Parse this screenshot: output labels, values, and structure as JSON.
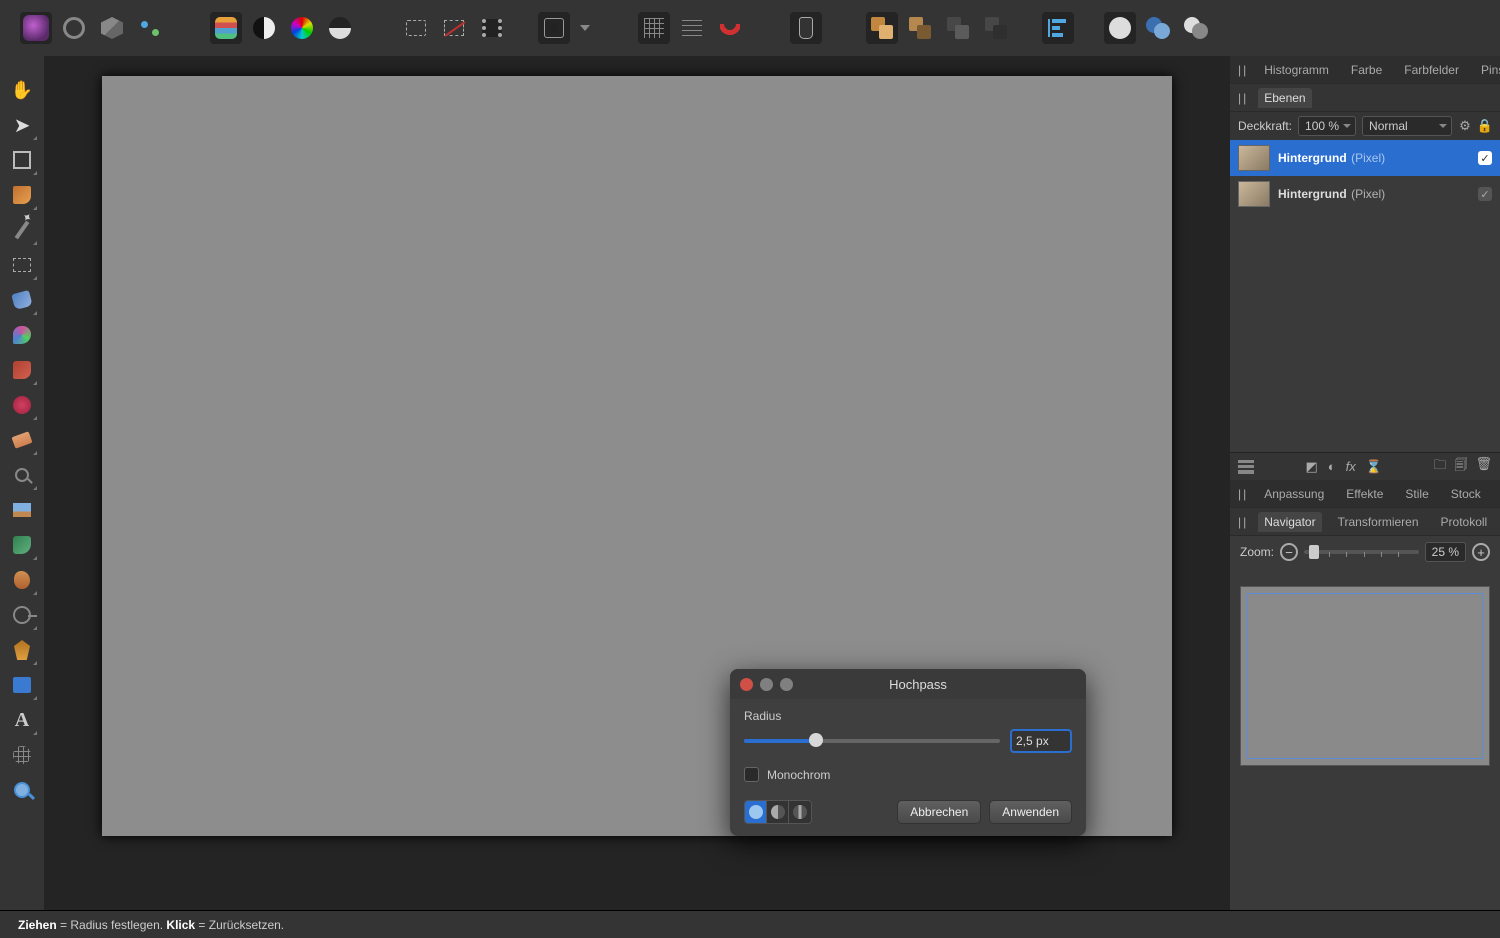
{
  "toolbar": {
    "quick_look_caret": "▾"
  },
  "right_panel": {
    "tabs_row1": {
      "histogram": "Histogramm",
      "color": "Farbe",
      "swatches": "Farbfelder",
      "brush": "Pinsel"
    },
    "tabs_row2": {
      "layers": "Ebenen"
    },
    "opacity_label": "Deckkraft:",
    "opacity_value": "100 %",
    "blend_mode": "Normal",
    "layers": [
      {
        "name": "Hintergrund",
        "type": "(Pixel)",
        "selected": true,
        "checked": true
      },
      {
        "name": "Hintergrund",
        "type": "(Pixel)",
        "selected": false,
        "checked": true
      }
    ],
    "tabs_row3": {
      "adjust": "Anpassung",
      "fx": "Effekte",
      "styles": "Stile",
      "stock": "Stock"
    },
    "tabs_row4": {
      "navigator": "Navigator",
      "transform": "Transformieren",
      "history": "Protokoll"
    },
    "zoom_label": "Zoom:",
    "zoom_value": "25 %"
  },
  "dialog": {
    "title": "Hochpass",
    "radius_label": "Radius",
    "radius_value": "2,5 px",
    "monochrome_label": "Monochrom",
    "cancel": "Abbrechen",
    "apply": "Anwenden"
  },
  "statusbar": {
    "drag_bold": "Ziehen",
    "drag_rest": " = Radius festlegen. ",
    "click_bold": "Klick",
    "click_rest": " = Zurücksetzen."
  }
}
